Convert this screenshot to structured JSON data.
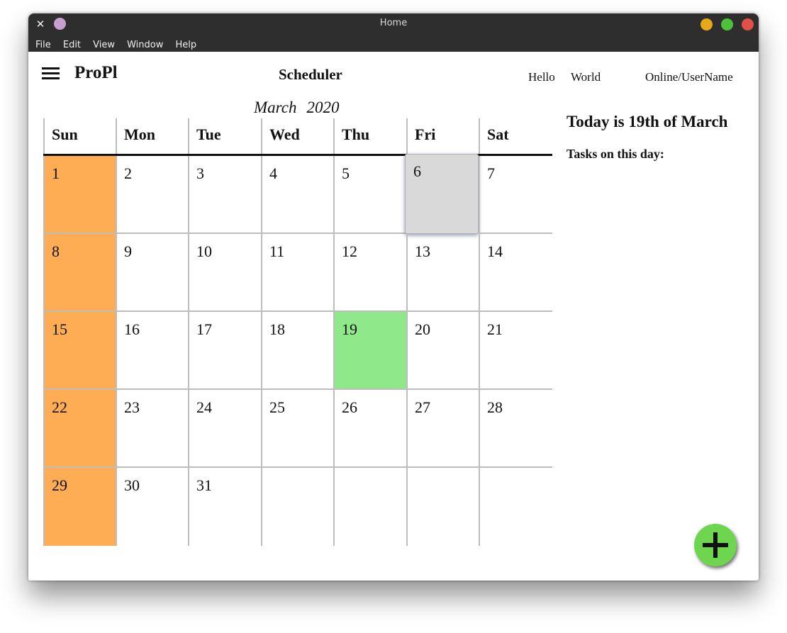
{
  "window": {
    "title": "Home",
    "menu": [
      "File",
      "Edit",
      "View",
      "Window",
      "Help"
    ]
  },
  "header": {
    "app_name": "ProPl",
    "page_title": "Scheduler",
    "greeting_hello": "Hello",
    "greeting_world": "World",
    "user_status": "Online/UserName"
  },
  "calendar": {
    "month": "March",
    "year": "2020",
    "weekdays": [
      "Sun",
      "Mon",
      "Tue",
      "Wed",
      "Thu",
      "Fri",
      "Sat"
    ],
    "weeks": [
      [
        "1",
        "2",
        "3",
        "4",
        "5",
        "6",
        "7"
      ],
      [
        "8",
        "9",
        "10",
        "11",
        "12",
        "13",
        "14"
      ],
      [
        "15",
        "16",
        "17",
        "18",
        "19",
        "20",
        "21"
      ],
      [
        "22",
        "23",
        "24",
        "25",
        "26",
        "27",
        "28"
      ],
      [
        "29",
        "30",
        "31",
        "",
        "",
        "",
        ""
      ]
    ],
    "today": "19",
    "hovered": "6",
    "colors": {
      "weekend": "#ffad55",
      "today": "#8fe88a",
      "hover": "#d9d9d9"
    }
  },
  "side_panel": {
    "title": "Today is 19th of March",
    "tasks_label": "Tasks on this day:"
  },
  "fab": {
    "icon": "plus-icon",
    "color": "#6ed64e"
  }
}
